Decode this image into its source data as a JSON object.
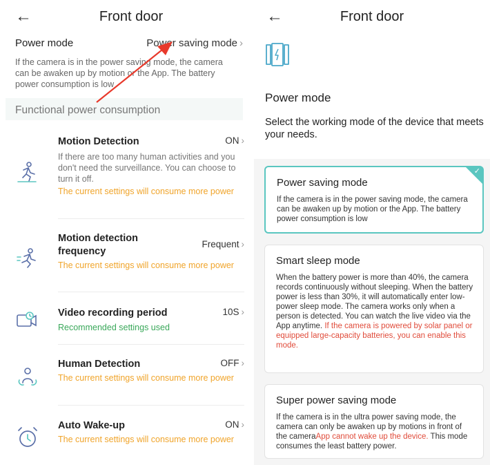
{
  "left": {
    "header": {
      "back_icon": "←",
      "title": "Front door"
    },
    "power_mode": {
      "label": "Power mode",
      "value": "Power saving mode",
      "chevron": "›",
      "description": "If the camera is in the power saving mode, the camera can be awaken up by motion or the App. The battery power consumption is low"
    },
    "section_title": "Functional power consumption",
    "items": [
      {
        "icon": "running-person-icon",
        "title": "Motion Detection",
        "value": "ON",
        "description": "If there are too many human activities and you don't need the surveillance. You can choose to turn it off.",
        "note": "The current settings will consume more power"
      },
      {
        "icon": "sprinting-person-icon",
        "title": "Motion detection frequency",
        "value": "Frequent",
        "note": "The current settings will consume more power"
      },
      {
        "icon": "video-camera-clock-icon",
        "title": "Video recording period",
        "value": "10S",
        "note": "Recommended settings used"
      },
      {
        "icon": "human-detection-icon",
        "title": "Human Detection",
        "value": "OFF",
        "note": "The current settings will consume more power"
      },
      {
        "icon": "alarm-clock-icon",
        "title": "Auto Wake-up",
        "value": "ON",
        "note": "The current settings will consume more power"
      }
    ]
  },
  "right": {
    "header": {
      "back_icon": "←",
      "title": "Front door"
    },
    "device_icon": "battery-device-icon",
    "label": "Power mode",
    "subtitle": "Select the working mode of the device that meets your needs.",
    "modes": [
      {
        "title": "Power saving mode",
        "selected": true,
        "description": "If the camera is in the power saving mode, the camera can be awaken up by motion or the App. The battery power consumption is low"
      },
      {
        "title": "Smart sleep mode",
        "selected": false,
        "description": "When the battery power is more than 40%, the camera records continuously without sleeping. When the battery power is less than 30%, it will automatically enter low-power sleep mode. The camera works only when a person is detected. You can watch the live video via the App anytime.",
        "warning": "If the camera is powered by solar panel or equipped large-capacity batteries, you can enable this mode."
      },
      {
        "title": "Super power saving mode",
        "selected": false,
        "description_before": "If the camera is in the ultra power saving mode, the camera can only be awaken up by motions in front of the camera",
        "warning": "App cannot wake up the device.",
        "description_after": " This mode consumes the least battery power."
      }
    ]
  },
  "colors": {
    "accent": "#5ac6c0",
    "warning": "#f0a42a",
    "ok": "#3aa85a",
    "red": "#e04b3a",
    "annotation_arrow": "#e8392b"
  }
}
